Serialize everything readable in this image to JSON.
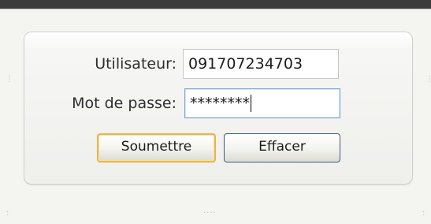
{
  "form": {
    "username_label": "Utilisateur:",
    "username_value": "091707234703",
    "password_label": "Mot de passe:",
    "password_masked_value": "********",
    "submit_label": "Soumettre",
    "clear_label": "Effacer"
  },
  "colors": {
    "top_bar": "#3c3c3c",
    "focused_field_border": "#7ea6d0",
    "default_button_border": "#e8b54b",
    "button_border": "#3f5c7a"
  }
}
